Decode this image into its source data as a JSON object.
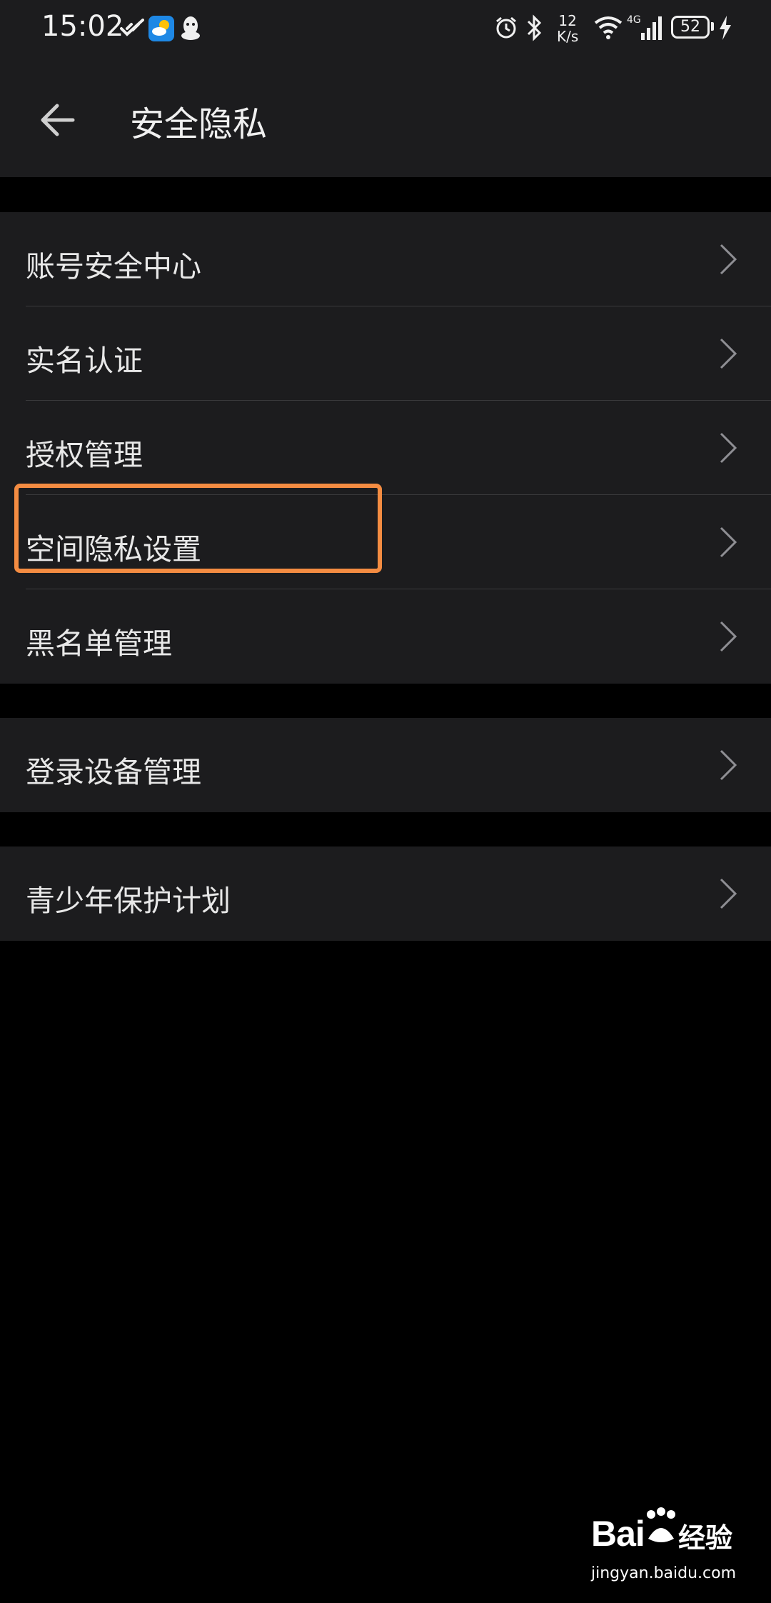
{
  "status_bar": {
    "time": "15:02",
    "speed_value": "12",
    "speed_unit": "K/s",
    "network": "4G",
    "battery": "52",
    "icons": [
      "health-icon",
      "weather-icon",
      "qq-icon",
      "alarm-icon",
      "bluetooth-icon",
      "wifi-icon",
      "signal-icon",
      "charging-icon"
    ]
  },
  "header": {
    "title": "安全隐私",
    "back_icon": "arrow-left-icon"
  },
  "groups": [
    {
      "items": [
        {
          "label": "账号安全中心"
        },
        {
          "label": "实名认证"
        },
        {
          "label": "授权管理"
        },
        {
          "label": "空间隐私设置",
          "highlighted": true
        },
        {
          "label": "黑名单管理"
        }
      ]
    },
    {
      "items": [
        {
          "label": "登录设备管理"
        }
      ]
    },
    {
      "items": [
        {
          "label": "青少年保护计划"
        }
      ]
    }
  ],
  "watermark": {
    "brand": "Bai",
    "product": "经验",
    "url": "jingyan.baidu.com"
  },
  "colors": {
    "background": "#000000",
    "surface": "#1c1c1e",
    "divider": "#3a3a3c",
    "text": "#e8e8e8",
    "chevron": "#8e8e93",
    "highlight": "#f48c42"
  }
}
